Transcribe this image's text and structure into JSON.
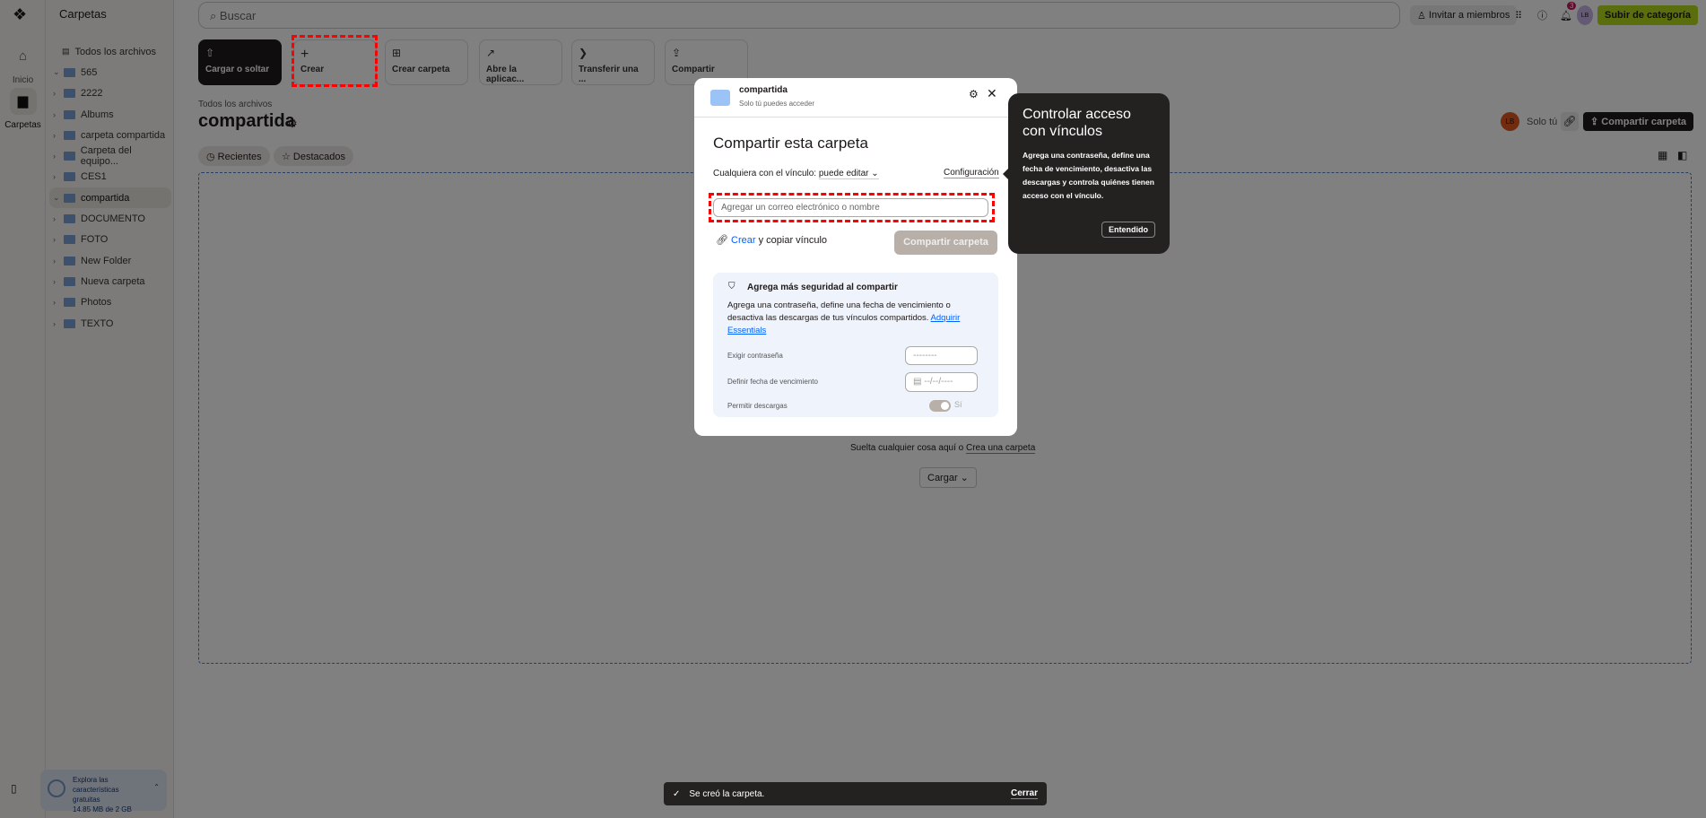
{
  "rail": {
    "items": [
      {
        "label": "Inicio",
        "icon": "home-icon"
      },
      {
        "label": "Carpetas",
        "icon": "folder-icon"
      }
    ]
  },
  "sidebar": {
    "title": "Carpetas",
    "all_files": "Todos los archivos",
    "folders": [
      "565",
      "2222",
      "Albums",
      "carpeta compartida",
      "Carpeta del equipo...",
      "CES1",
      "compartida",
      "DOCUMENTO",
      "FOTO",
      "New Folder",
      "Nueva carpeta",
      "Photos",
      "TEXTO"
    ],
    "selected": "compartida",
    "promo": {
      "line1": "Explora las características gratuitas",
      "usage": "14.85 MB de 2 GB"
    }
  },
  "header": {
    "search_placeholder": "Buscar",
    "invite": "Invitar a miembros",
    "notifications": "3",
    "avatar": "LB",
    "upgrade": "Subir de categoría"
  },
  "tiles": [
    "Cargar o soltar",
    "Crear",
    "Crear carpeta",
    "Abre la aplicac...",
    "Transferir una ...",
    "Compartir"
  ],
  "main": {
    "breadcrumb": "Todos los archivos",
    "title": "compartida",
    "chips": [
      "Recientes",
      "Destacados"
    ],
    "owner_avatar": "LB",
    "owner_text": "Solo tú",
    "share_button": "Compartir carpeta",
    "drop_text": "Suelta cualquier cosa aquí o",
    "drop_link": "Crea una carpeta",
    "upload": "Cargar"
  },
  "modal": {
    "folder": "compartida",
    "access": "Solo tú puedes acceder",
    "heading": "Compartir esta carpeta",
    "link_label": "Cualquiera con el vínculo:",
    "link_perm": "puede editar",
    "settings": "Configuración",
    "email_placeholder": "Agregar un correo electrónico o nombre",
    "create": "Crear",
    "copy_link": "y copiar vínculo",
    "share": "Compartir carpeta",
    "security": {
      "title": "Agrega más seguridad al compartir",
      "body": "Agrega una contraseña, define una fecha de vencimiento o desactiva las descargas de tus vínculos compartidos.",
      "link": "Adquirir Essentials",
      "password_label": "Exigir contraseña",
      "password_value": "--------",
      "expiry_label": "Definir fecha de vencimiento",
      "expiry_value": "--/--/----",
      "downloads_label": "Permitir descargas",
      "downloads_value": "Sí"
    }
  },
  "tooltip": {
    "title": "Controlar acceso con vínculos",
    "body": "Agrega una contraseña, define una fecha de vencimiento, desactiva las descargas y controla quiénes tienen acceso con el vínculo.",
    "button": "Entendido"
  },
  "toast": {
    "message": "Se creó la carpeta.",
    "close": "Cerrar"
  }
}
